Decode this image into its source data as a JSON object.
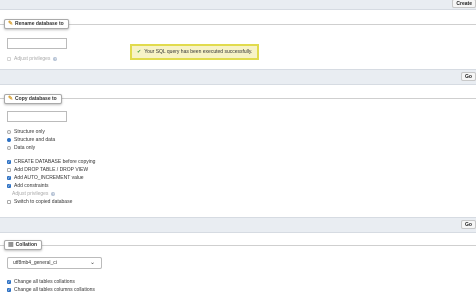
{
  "top": {
    "create_label": "Create"
  },
  "rename": {
    "legend": "Rename database to",
    "input_value": "",
    "adjust_privileges": "Adjust privileges",
    "go_label": "Go"
  },
  "toast": {
    "message": "Your SQL query has been executed successfully."
  },
  "copy": {
    "legend": "Copy database to",
    "input_value": "",
    "radios": [
      {
        "label": "Structure only",
        "checked": false
      },
      {
        "label": "Structure and data",
        "checked": true
      },
      {
        "label": "Data only",
        "checked": false
      }
    ],
    "checks": [
      {
        "label": "CREATE DATABASE before copying",
        "checked": true
      },
      {
        "label": "Add DROP TABLE / DROP VIEW",
        "checked": false
      },
      {
        "label": "Add AUTO_INCREMENT value",
        "checked": true
      },
      {
        "label": "Add constraints",
        "checked": true
      },
      {
        "label": "Adjust privileges",
        "checked": false,
        "disabled": true
      },
      {
        "label": "Switch to copied database",
        "checked": false
      }
    ],
    "go_label": "Go"
  },
  "collation": {
    "legend": "Collation",
    "selected": "utf8mb4_general_ci",
    "checks": [
      {
        "label": "Change all tables collations",
        "checked": true
      },
      {
        "label": "Change all tables columns collations",
        "checked": true
      }
    ]
  },
  "colors": {
    "accent": "#2f72c4",
    "bar": "#e9edf2",
    "toast_bg": "#f7f3c6",
    "toast_border": "#e1db4d"
  }
}
